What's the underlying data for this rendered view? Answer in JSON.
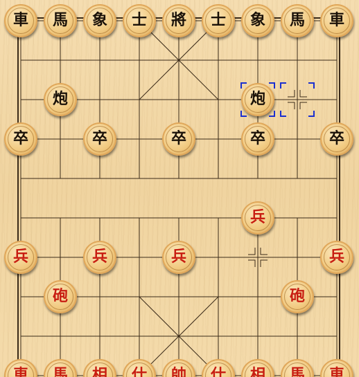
{
  "board": {
    "files": 9,
    "ranks": 10,
    "river_text": "",
    "colors": {
      "wood_light": "#f5ddb0",
      "wood_dark": "#d9a050",
      "line": "#3a2a18",
      "black_piece_text": "#1a1108",
      "red_piece_text": "#c81e12",
      "selection": "#1a2fd0"
    }
  },
  "pieces": [
    {
      "name": "black-chariot-left",
      "side": "black",
      "char": "車",
      "file": 0,
      "rank": 0
    },
    {
      "name": "black-horse-left",
      "side": "black",
      "char": "馬",
      "file": 1,
      "rank": 0
    },
    {
      "name": "black-elephant-left",
      "side": "black",
      "char": "象",
      "file": 2,
      "rank": 0
    },
    {
      "name": "black-advisor-left",
      "side": "black",
      "char": "士",
      "file": 3,
      "rank": 0
    },
    {
      "name": "black-general",
      "side": "black",
      "char": "將",
      "file": 4,
      "rank": 0
    },
    {
      "name": "black-advisor-right",
      "side": "black",
      "char": "士",
      "file": 5,
      "rank": 0
    },
    {
      "name": "black-elephant-right",
      "side": "black",
      "char": "象",
      "file": 6,
      "rank": 0
    },
    {
      "name": "black-horse-right",
      "side": "black",
      "char": "馬",
      "file": 7,
      "rank": 0
    },
    {
      "name": "black-chariot-right",
      "side": "black",
      "char": "車",
      "file": 8,
      "rank": 0
    },
    {
      "name": "black-cannon-left",
      "side": "black",
      "char": "炮",
      "file": 1,
      "rank": 2
    },
    {
      "name": "black-cannon-right",
      "side": "black",
      "char": "炮",
      "file": 6,
      "rank": 2
    },
    {
      "name": "black-soldier-1",
      "side": "black",
      "char": "卒",
      "file": 0,
      "rank": 3
    },
    {
      "name": "black-soldier-2",
      "side": "black",
      "char": "卒",
      "file": 2,
      "rank": 3
    },
    {
      "name": "black-soldier-3",
      "side": "black",
      "char": "卒",
      "file": 4,
      "rank": 3
    },
    {
      "name": "black-soldier-4",
      "side": "black",
      "char": "卒",
      "file": 6,
      "rank": 3
    },
    {
      "name": "black-soldier-5",
      "side": "black",
      "char": "卒",
      "file": 8,
      "rank": 3
    },
    {
      "name": "red-soldier-advanced",
      "side": "red",
      "char": "兵",
      "file": 6,
      "rank": 5
    },
    {
      "name": "red-soldier-1",
      "side": "red",
      "char": "兵",
      "file": 0,
      "rank": 6
    },
    {
      "name": "red-soldier-2",
      "side": "red",
      "char": "兵",
      "file": 2,
      "rank": 6
    },
    {
      "name": "red-soldier-3",
      "side": "red",
      "char": "兵",
      "file": 4,
      "rank": 6
    },
    {
      "name": "red-soldier-5",
      "side": "red",
      "char": "兵",
      "file": 8,
      "rank": 6
    },
    {
      "name": "red-cannon-left",
      "side": "red",
      "char": "砲",
      "file": 1,
      "rank": 7
    },
    {
      "name": "red-cannon-right",
      "side": "red",
      "char": "砲",
      "file": 7,
      "rank": 7
    },
    {
      "name": "red-chariot-left",
      "side": "red",
      "char": "車",
      "file": 0,
      "rank": 9
    },
    {
      "name": "red-horse-left",
      "side": "red",
      "char": "馬",
      "file": 1,
      "rank": 9
    },
    {
      "name": "red-elephant-left",
      "side": "red",
      "char": "相",
      "file": 2,
      "rank": 9
    },
    {
      "name": "red-advisor-left",
      "side": "red",
      "char": "仕",
      "file": 3,
      "rank": 9
    },
    {
      "name": "red-general",
      "side": "red",
      "char": "帥",
      "file": 4,
      "rank": 9
    },
    {
      "name": "red-advisor-right",
      "side": "red",
      "char": "仕",
      "file": 5,
      "rank": 9
    },
    {
      "name": "red-elephant-right",
      "side": "red",
      "char": "相",
      "file": 6,
      "rank": 9
    },
    {
      "name": "red-horse-right",
      "side": "red",
      "char": "馬",
      "file": 7,
      "rank": 9
    },
    {
      "name": "red-chariot-right",
      "side": "red",
      "char": "車",
      "file": 8,
      "rank": 9
    }
  ],
  "last_move": {
    "from": {
      "file": 7,
      "rank": 2
    },
    "to": {
      "file": 6,
      "rank": 2
    }
  }
}
